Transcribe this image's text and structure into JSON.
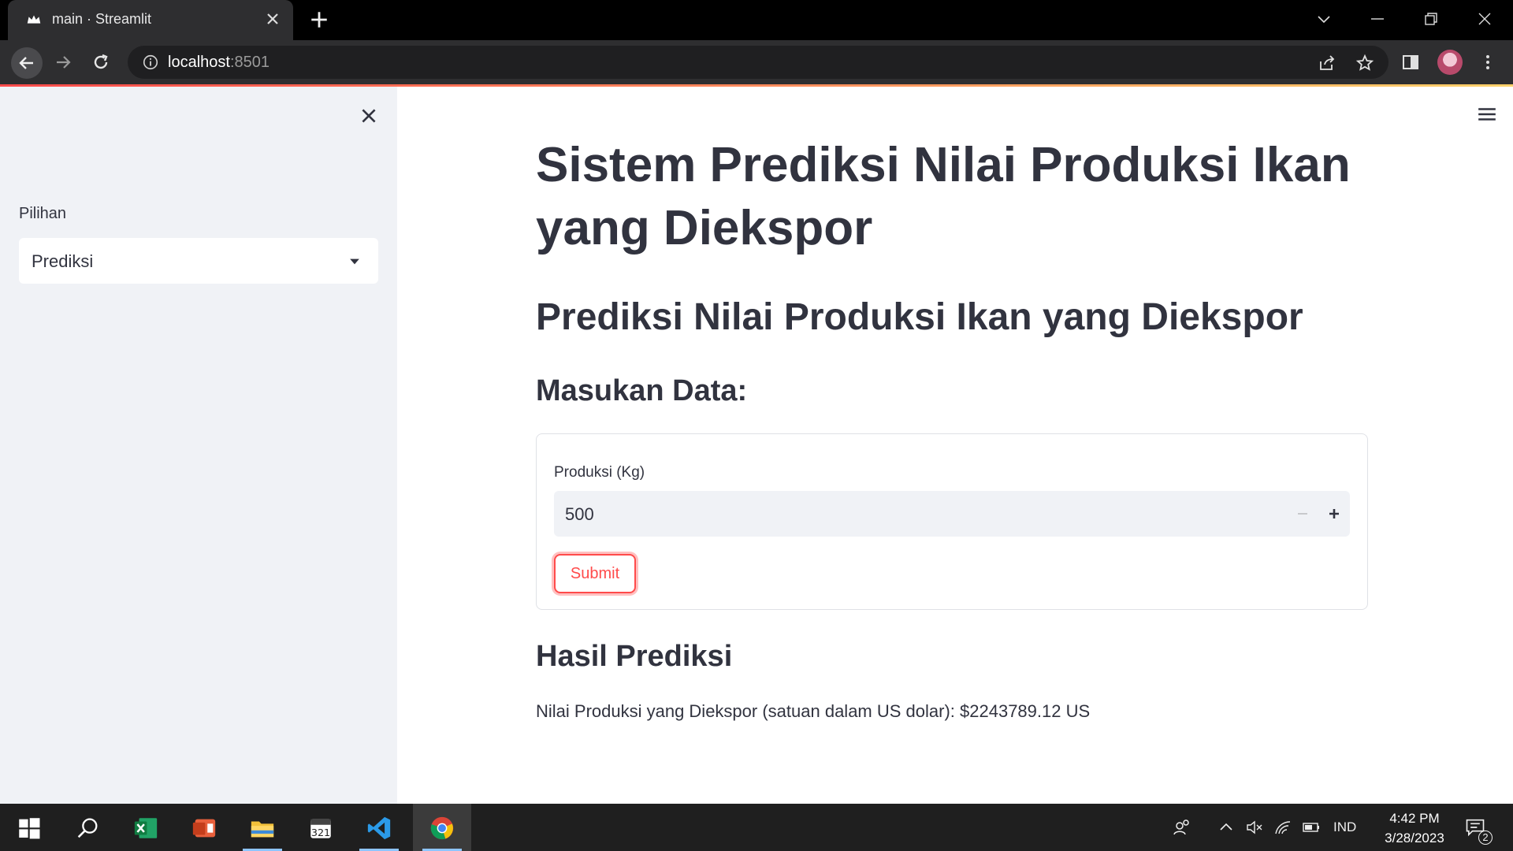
{
  "browser": {
    "tab_title": "main · Streamlit",
    "url_host": "localhost",
    "url_port": ":8501"
  },
  "sidebar": {
    "select_label": "Pilihan",
    "select_value": "Prediksi"
  },
  "main": {
    "title": "Sistem Prediksi Nilai Produksi Ikan yang Diekspor",
    "subtitle": "Prediksi Nilai Produksi Ikan yang Diekspor",
    "form_heading": "Masukan Data:",
    "field_label": "Produksi (Kg)",
    "field_value": "500",
    "submit_label": "Submit",
    "result_heading": "Hasil Prediksi",
    "result_text": "Nilai Produksi yang Diekspor (satuan dalam US dolar): $2243789.12 US"
  },
  "taskbar": {
    "language": "IND",
    "time": "4:42 PM",
    "date": "3/28/2023",
    "notification_count": "2"
  },
  "colors": {
    "accent": "#ff4b4b",
    "text": "#31333f",
    "sidebar_bg": "#f0f2f6"
  }
}
